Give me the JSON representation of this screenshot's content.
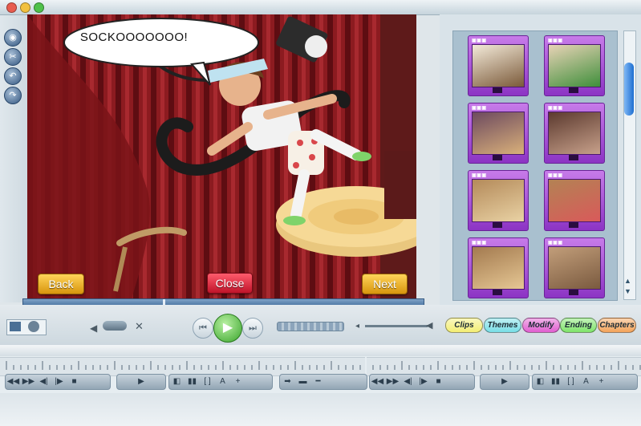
{
  "window": {
    "traffic_lights": [
      "#e85c4f",
      "#f2c13f",
      "#4fc14a"
    ]
  },
  "left_tools": [
    "camera-icon",
    "scissors-icon",
    "undo-icon",
    "redo-icon"
  ],
  "stage": {
    "speech_bubble": "SOCKOOOOOOO!",
    "back_label": "Back",
    "close_label": "Close",
    "next_label": "Next",
    "progress": 0.35
  },
  "clip_browser": {
    "thumbnails": [
      {
        "id": "thumb-1",
        "colors": [
          "#f3ead9",
          "#7b5a3a"
        ]
      },
      {
        "id": "thumb-2",
        "colors": [
          "#e8d3b6",
          "#3f8f3b"
        ]
      },
      {
        "id": "thumb-3",
        "colors": [
          "#6d4a5f",
          "#d9b07a"
        ]
      },
      {
        "id": "thumb-4",
        "colors": [
          "#5c3a2f",
          "#c7a08a"
        ]
      },
      {
        "id": "thumb-5",
        "colors": [
          "#b48a5a",
          "#e9d2a4"
        ]
      },
      {
        "id": "thumb-6",
        "colors": [
          "#b38254",
          "#d95a5a"
        ]
      },
      {
        "id": "thumb-7",
        "colors": [
          "#a37a4f",
          "#e6c794"
        ]
      },
      {
        "id": "thumb-8",
        "colors": [
          "#c29e7a",
          "#7a5a3f"
        ]
      }
    ],
    "scroll_position": 0.15
  },
  "playback": {
    "volume": 0.55,
    "progress": 0.45
  },
  "category_pills": [
    {
      "label": "Clips",
      "color": "#f3ee74"
    },
    {
      "label": "Themes",
      "color": "#78dde6"
    },
    {
      "label": "Modify",
      "color": "#e05ed0"
    },
    {
      "label": "Ending",
      "color": "#7fe46a"
    },
    {
      "label": "Chapters",
      "color": "#f3a35a"
    }
  ]
}
